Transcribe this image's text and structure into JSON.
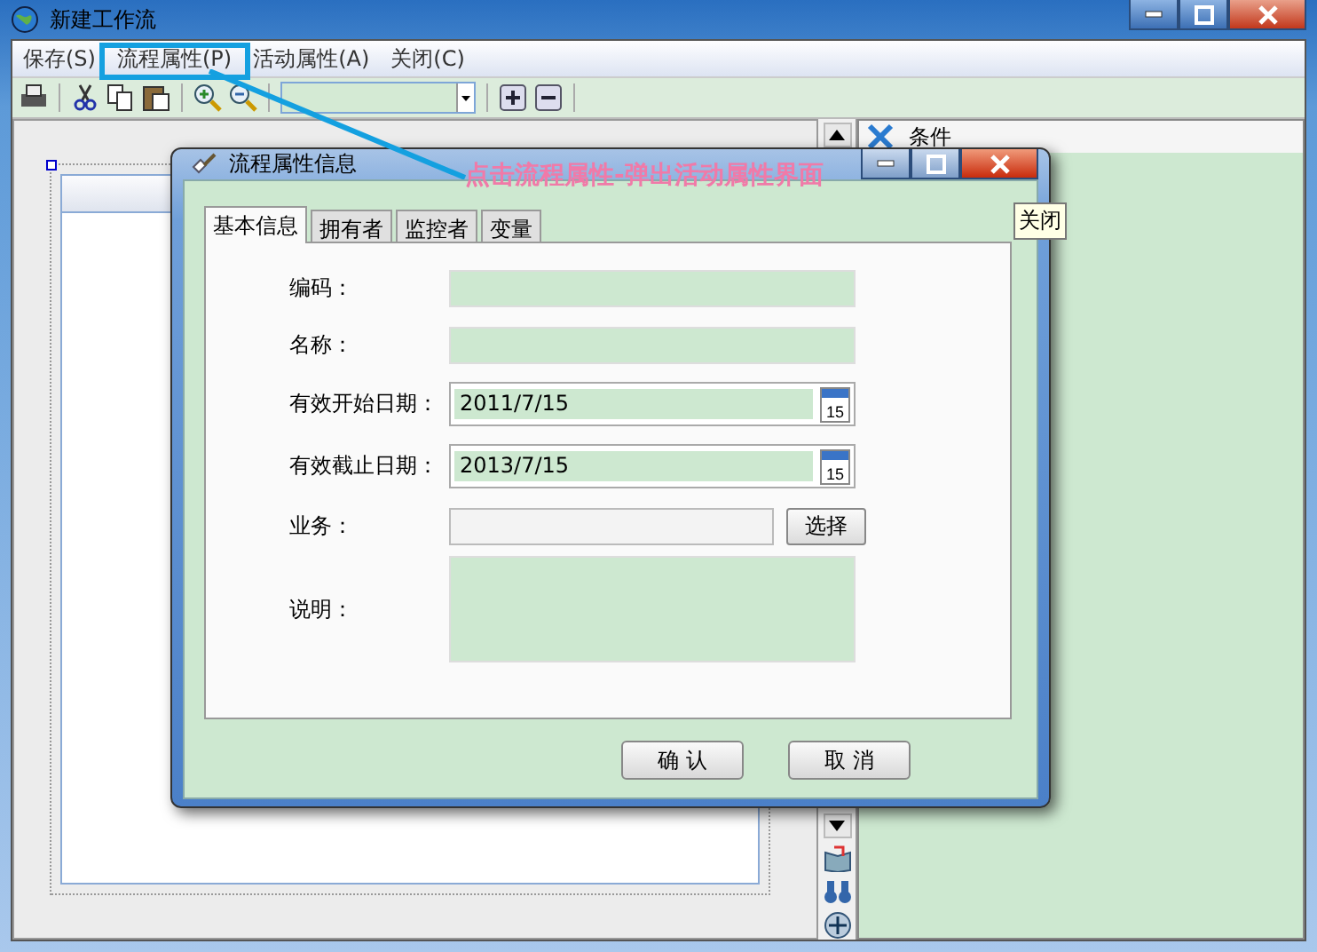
{
  "window": {
    "title": "新建工作流"
  },
  "menu": [
    {
      "label": "保存(S)",
      "highlighted": false
    },
    {
      "label": "流程属性(P)",
      "highlighted": true
    },
    {
      "label": "活动属性(A)",
      "highlighted": false
    },
    {
      "label": "关闭(C)",
      "highlighted": false
    }
  ],
  "right_panel": {
    "title": "条件"
  },
  "annotation": {
    "text": "点击流程属性-弹出活动属性界面"
  },
  "dialog": {
    "title": "流程属性信息",
    "tabs": [
      {
        "label": "基本信息",
        "selected": true
      },
      {
        "label": "拥有者",
        "selected": false
      },
      {
        "label": "监控者",
        "selected": false
      },
      {
        "label": "变量",
        "selected": false
      }
    ],
    "fields": [
      {
        "kind": "text",
        "label": "编码："
      },
      {
        "kind": "text",
        "label": "名称："
      },
      {
        "kind": "date",
        "label": "有效开始日期：",
        "value": "2011/7/15",
        "calendar_day": "15"
      },
      {
        "kind": "date",
        "label": "有效截止日期：",
        "value": "2013/7/15",
        "calendar_day": "15"
      },
      {
        "kind": "picker",
        "label": "业务：",
        "button": "选择"
      },
      {
        "kind": "textarea",
        "label": "说明："
      }
    ],
    "buttons": [
      "确 认",
      "取 消"
    ],
    "tooltip": "关闭"
  }
}
